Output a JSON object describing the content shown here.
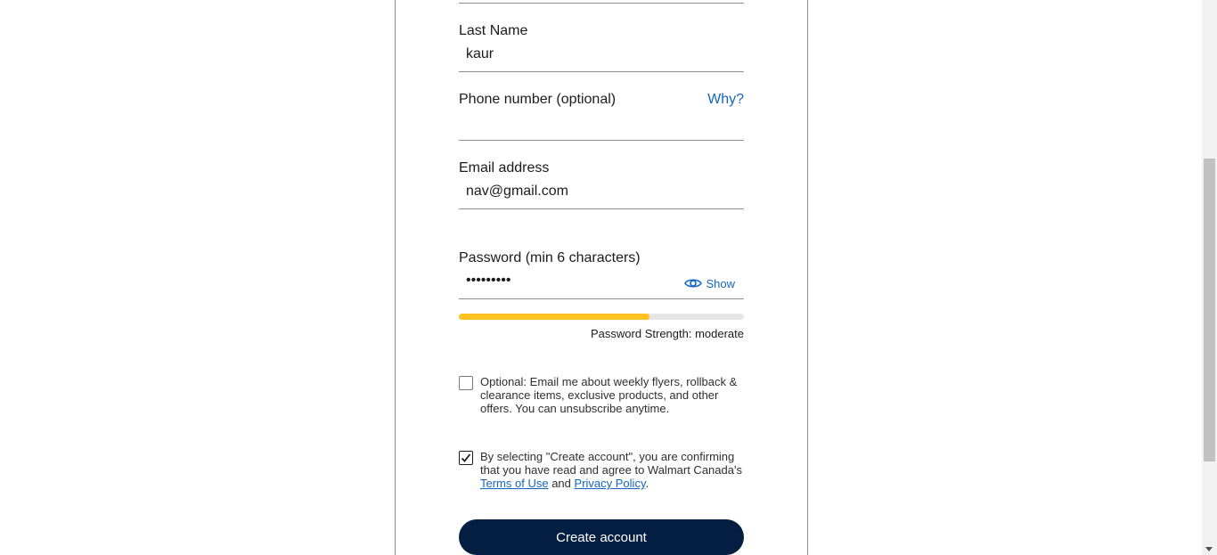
{
  "form": {
    "last_name": {
      "label": "Last Name",
      "value": "kaur"
    },
    "phone": {
      "label": "Phone number (optional)",
      "value": "",
      "why_link": "Why?"
    },
    "email": {
      "label": "Email address",
      "value": "nav@gmail.com"
    },
    "password": {
      "label": "Password (min 6 characters)",
      "value": "•••••••••",
      "show_label": "Show",
      "show_icon": "eye-icon",
      "strength_text": "Password Strength: moderate",
      "strength_fraction": 0.67
    },
    "optin": {
      "checked": false,
      "text": "Optional: Email me about weekly flyers, rollback & clearance items, exclusive products, and other offers. You can unsubscribe anytime."
    },
    "terms": {
      "checked": true,
      "text_before": "By selecting \"Create account\", you are confirming that you have read and agree to Walmart Canada's",
      "terms_link": "Terms of Use",
      "and_text": "and",
      "privacy_link": "Privacy Policy",
      "period": "."
    },
    "create_button": "Create account"
  },
  "colors": {
    "link": "#1565c0",
    "button_bg": "#041e42",
    "meter_fill": "#ffc220",
    "meter_track": "#e6e6e6"
  }
}
